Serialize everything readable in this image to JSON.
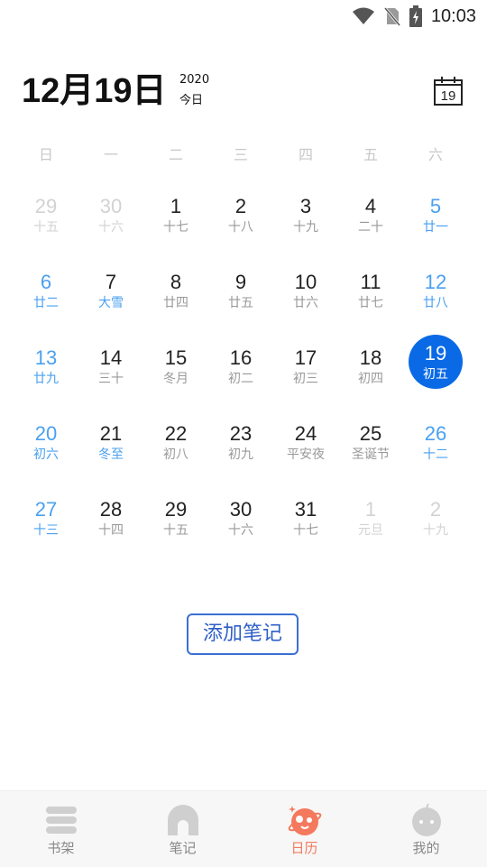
{
  "status": {
    "time": "10:03"
  },
  "header": {
    "date": "12月19日",
    "year": "2020",
    "today": "今日",
    "calendar_icon_day": "19"
  },
  "weekdays": [
    "日",
    "一",
    "二",
    "三",
    "四",
    "五",
    "六"
  ],
  "days": [
    {
      "num": "29",
      "lunar": "十五",
      "type": "other"
    },
    {
      "num": "30",
      "lunar": "十六",
      "type": "other"
    },
    {
      "num": "1",
      "lunar": "十七",
      "type": "normal"
    },
    {
      "num": "2",
      "lunar": "十八",
      "type": "normal"
    },
    {
      "num": "3",
      "lunar": "十九",
      "type": "normal"
    },
    {
      "num": "4",
      "lunar": "二十",
      "type": "normal"
    },
    {
      "num": "5",
      "lunar": "廿一",
      "type": "weekend"
    },
    {
      "num": "6",
      "lunar": "廿二",
      "type": "weekend"
    },
    {
      "num": "7",
      "lunar": "大雪",
      "type": "term"
    },
    {
      "num": "8",
      "lunar": "廿四",
      "type": "normal"
    },
    {
      "num": "9",
      "lunar": "廿五",
      "type": "normal"
    },
    {
      "num": "10",
      "lunar": "廿六",
      "type": "normal"
    },
    {
      "num": "11",
      "lunar": "廿七",
      "type": "normal"
    },
    {
      "num": "12",
      "lunar": "廿八",
      "type": "weekend"
    },
    {
      "num": "13",
      "lunar": "廿九",
      "type": "weekend"
    },
    {
      "num": "14",
      "lunar": "三十",
      "type": "normal"
    },
    {
      "num": "15",
      "lunar": "冬月",
      "type": "normal"
    },
    {
      "num": "16",
      "lunar": "初二",
      "type": "normal"
    },
    {
      "num": "17",
      "lunar": "初三",
      "type": "normal"
    },
    {
      "num": "18",
      "lunar": "初四",
      "type": "normal"
    },
    {
      "num": "19",
      "lunar": "初五",
      "type": "selected"
    },
    {
      "num": "20",
      "lunar": "初六",
      "type": "weekend"
    },
    {
      "num": "21",
      "lunar": "冬至",
      "type": "term"
    },
    {
      "num": "22",
      "lunar": "初八",
      "type": "normal"
    },
    {
      "num": "23",
      "lunar": "初九",
      "type": "normal"
    },
    {
      "num": "24",
      "lunar": "平安夜",
      "type": "normal"
    },
    {
      "num": "25",
      "lunar": "圣诞节",
      "type": "normal"
    },
    {
      "num": "26",
      "lunar": "十二",
      "type": "weekend"
    },
    {
      "num": "27",
      "lunar": "十三",
      "type": "weekend"
    },
    {
      "num": "28",
      "lunar": "十四",
      "type": "normal"
    },
    {
      "num": "29",
      "lunar": "十五",
      "type": "normal"
    },
    {
      "num": "30",
      "lunar": "十六",
      "type": "normal"
    },
    {
      "num": "31",
      "lunar": "十七",
      "type": "normal"
    },
    {
      "num": "1",
      "lunar": "元旦",
      "type": "other"
    },
    {
      "num": "2",
      "lunar": "十九",
      "type": "other"
    }
  ],
  "add_note_label": "添加笔记",
  "nav": [
    {
      "label": "书架",
      "icon": "bookshelf-icon",
      "active": false
    },
    {
      "label": "笔记",
      "icon": "note-icon",
      "active": false
    },
    {
      "label": "日历",
      "icon": "planet-icon",
      "active": true
    },
    {
      "label": "我的",
      "icon": "profile-icon",
      "active": false
    }
  ],
  "colors": {
    "accent": "#0a6ae6",
    "weekend": "#4aa0f0",
    "nav_active": "#f4795d",
    "button_border": "#3b6fd3"
  }
}
